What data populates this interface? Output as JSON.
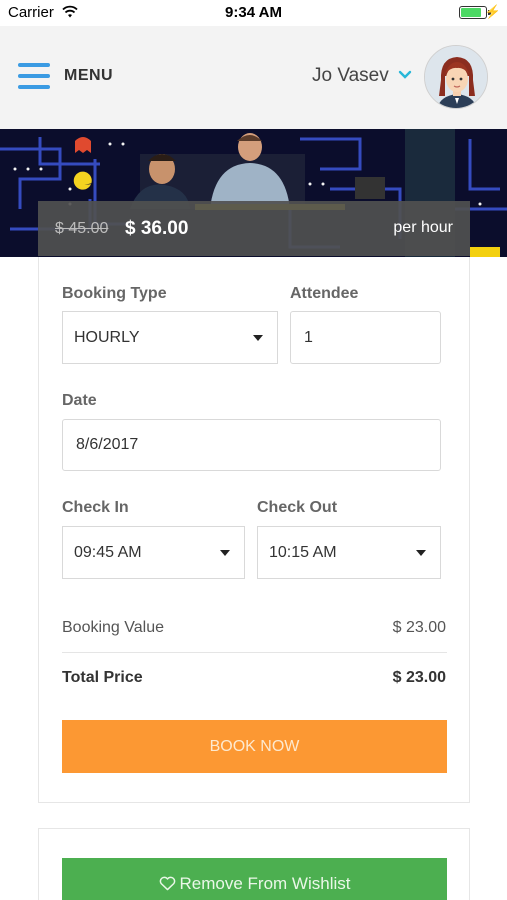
{
  "status_bar": {
    "carrier": "Carrier",
    "time": "9:34 AM"
  },
  "header": {
    "menu_label": "MENU",
    "user_name": "Jo Vasev"
  },
  "pricing": {
    "old_price": "$ 45.00",
    "new_price": "$ 36.00",
    "unit": "per hour"
  },
  "booking": {
    "booking_type_label": "Booking Type",
    "booking_type_value": "HOURLY",
    "attendee_label": "Attendee",
    "attendee_value": "1",
    "date_label": "Date",
    "date_value": "8/6/2017",
    "check_in_label": "Check In",
    "check_in_value": "09:45 AM",
    "check_out_label": "Check Out",
    "check_out_value": "10:15 AM",
    "booking_value_label": "Booking Value",
    "booking_value": "$ 23.00",
    "total_price_label": "Total Price",
    "total_price": "$ 23.00",
    "book_now_label": "BOOK NOW"
  },
  "wishlist": {
    "remove_label": "Remove From Wishlist"
  },
  "colors": {
    "accent_blue": "#3b9be3",
    "book_orange": "#fc9833",
    "wishlist_green": "#4caf50",
    "price_bar": "#505050"
  }
}
